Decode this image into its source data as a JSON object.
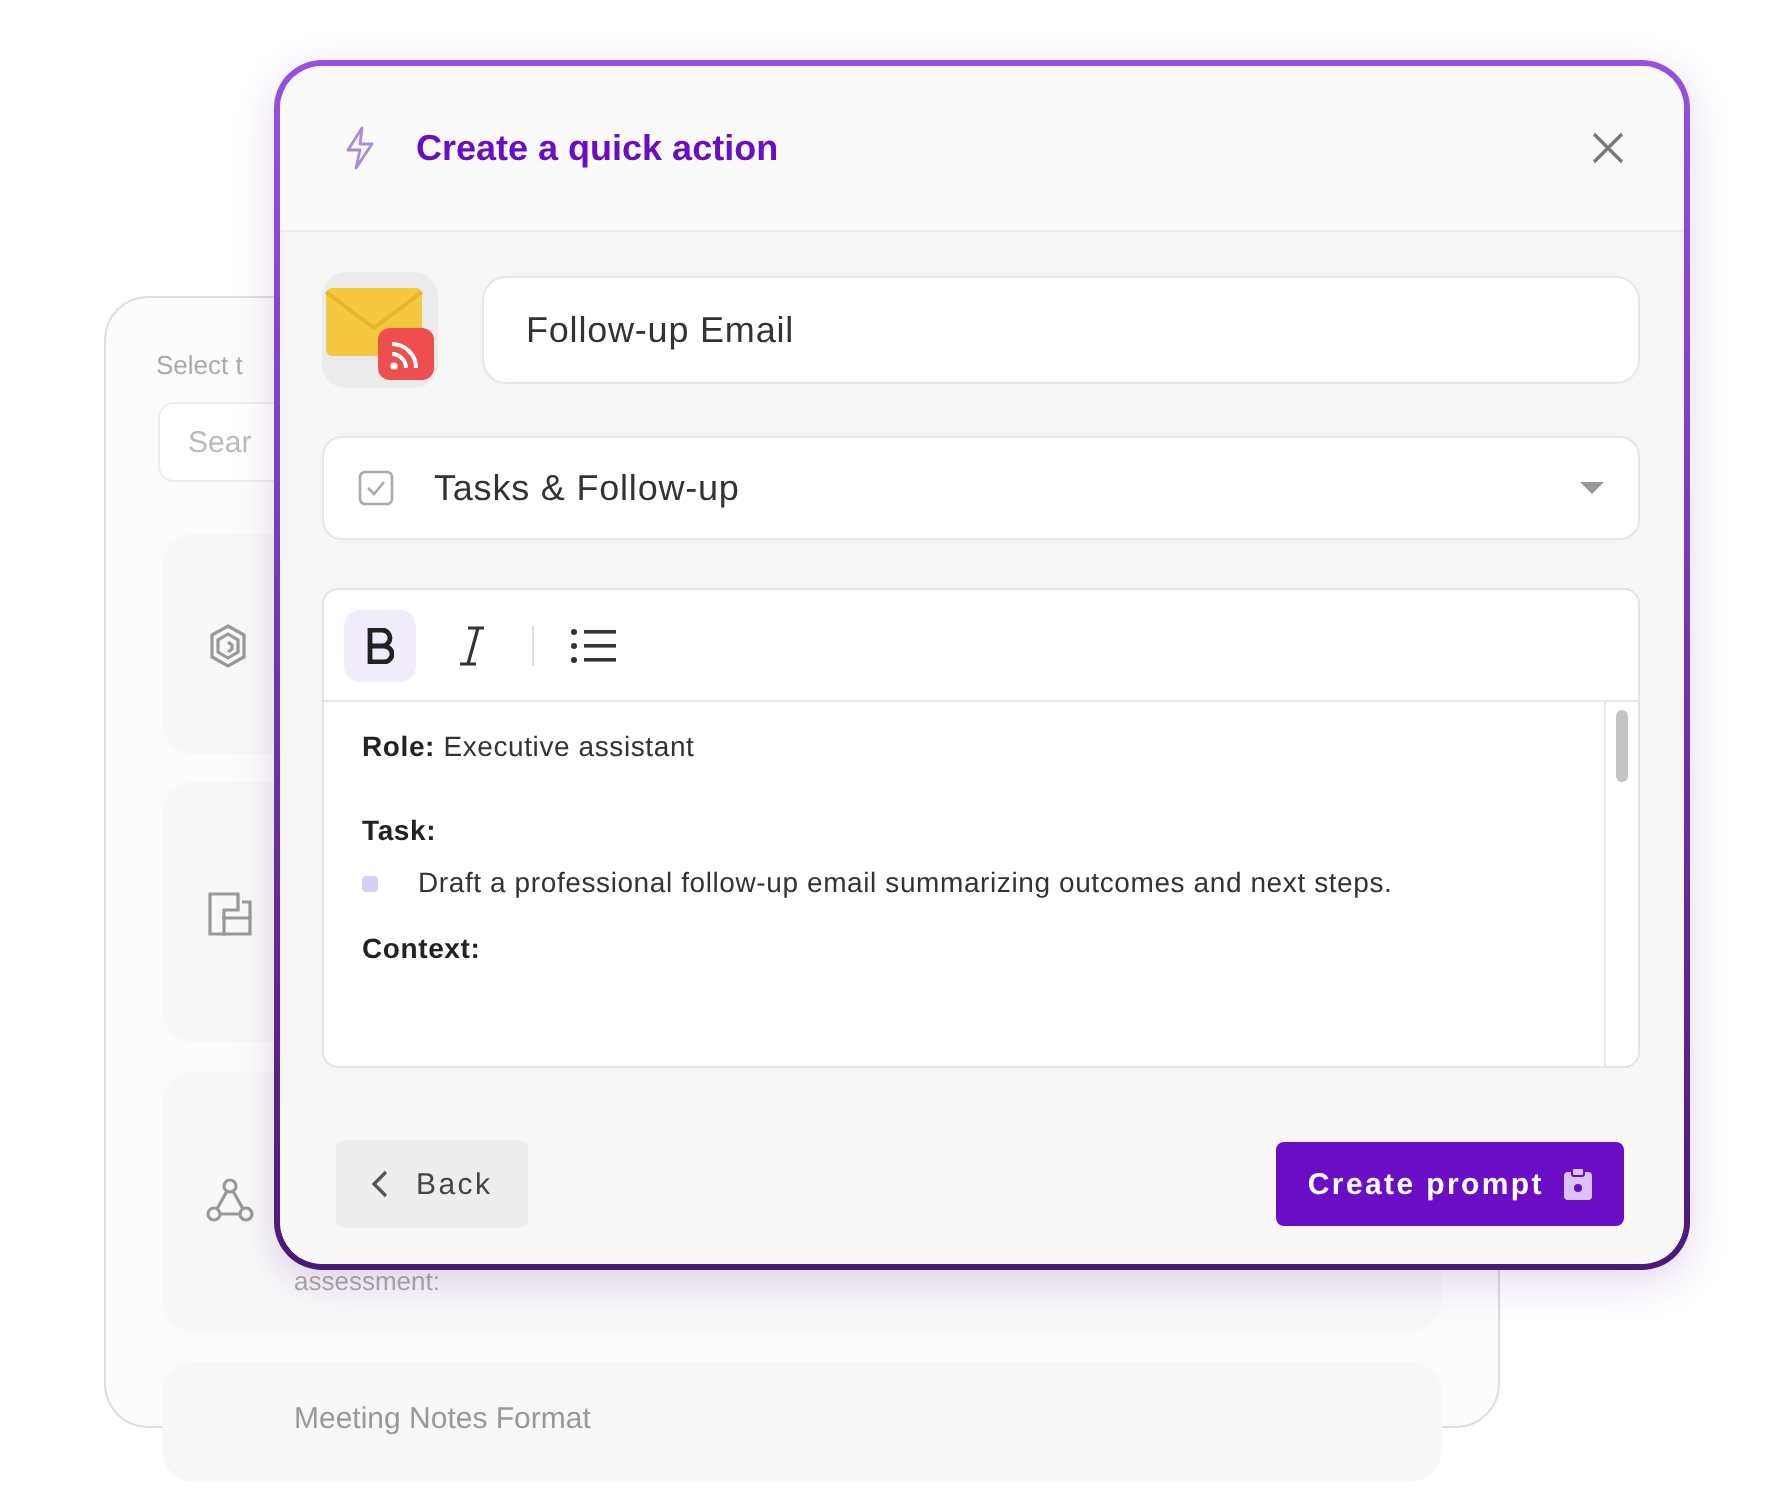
{
  "background_panel": {
    "label": "Select t",
    "search": {
      "placeholder": "Sear"
    },
    "cards": [
      {
        "kind": "hexagon"
      },
      {
        "kind": "squares"
      },
      {
        "kind": "nodes",
        "text": "assessment:"
      },
      {
        "kind": "plain",
        "title": "Meeting Notes Format"
      }
    ]
  },
  "modal": {
    "title": "Create a quick action",
    "name_field": {
      "value": "Follow-up Email"
    },
    "category": {
      "value": "Tasks & Follow-up"
    },
    "toolbar": [
      {
        "kind": "bold",
        "selected": true
      },
      {
        "kind": "italic",
        "selected": false
      },
      {
        "kind": "list",
        "selected": false
      }
    ],
    "content": [
      {
        "kind": "paragraph",
        "text": "**Role:** Executive assistant"
      },
      {
        "kind": "heading",
        "text": "Task:"
      },
      {
        "kind": "bullet",
        "text": "Draft a professional follow-up email summarizing outcomes and next steps."
      },
      {
        "kind": "heading",
        "text": "Context:"
      }
    ],
    "buttons": [
      {
        "kind": "back",
        "label": "Back"
      },
      {
        "kind": "primary",
        "label": "Create prompt"
      }
    ]
  }
}
